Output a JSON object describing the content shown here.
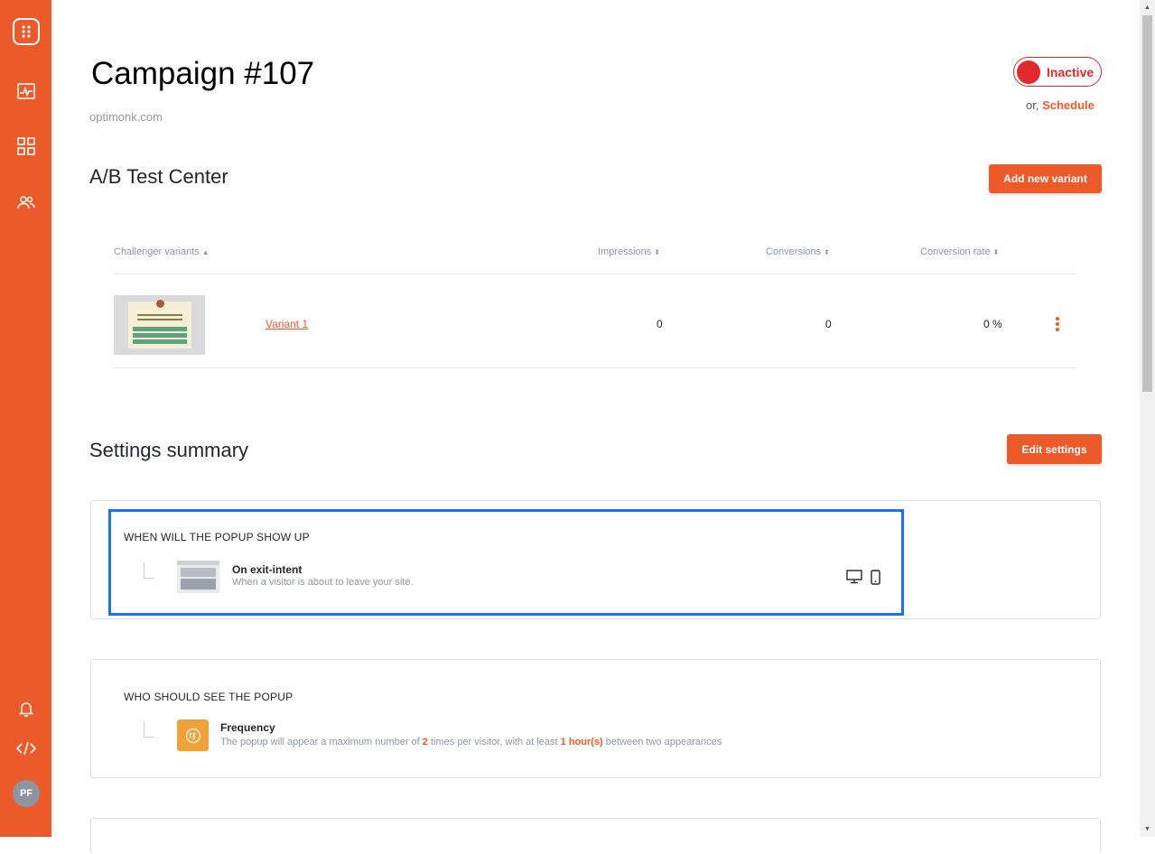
{
  "page": {
    "title": "Campaign #107",
    "domain": "optimonk.com"
  },
  "status": {
    "label": "Inactive",
    "schedule_prefix": "or,",
    "schedule_link": "Schedule"
  },
  "ab_test": {
    "title": "A/B Test Center",
    "add_button": "Add new variant",
    "columns": {
      "variants": "Challenger variants",
      "impressions": "Impressions",
      "conversions": "Conversions",
      "rate": "Conversion rate"
    },
    "rows": [
      {
        "name": "Variant 1",
        "impressions": "0",
        "conversions": "0",
        "rate": "0 %"
      }
    ]
  },
  "settings": {
    "title": "Settings summary",
    "edit_button": "Edit settings",
    "when": {
      "heading": "WHEN WILL THE POPUP SHOW UP",
      "item_title": "On exit-intent",
      "item_desc": "When a visitor is about to leave your site."
    },
    "who": {
      "heading": "WHO SHOULD SEE THE POPUP",
      "item_title": "Frequency",
      "desc_1": "The popup will appear a maximum number of",
      "times_value": "2",
      "desc_2": "times per visitor, with at least",
      "interval_value": "1 hour(s)",
      "desc_3": "between two appearances"
    }
  },
  "user": {
    "initials": "PF"
  },
  "colors": {
    "brand": "#ed5a29",
    "inactive": "#e2282f",
    "highlight": "#1a73e8"
  }
}
